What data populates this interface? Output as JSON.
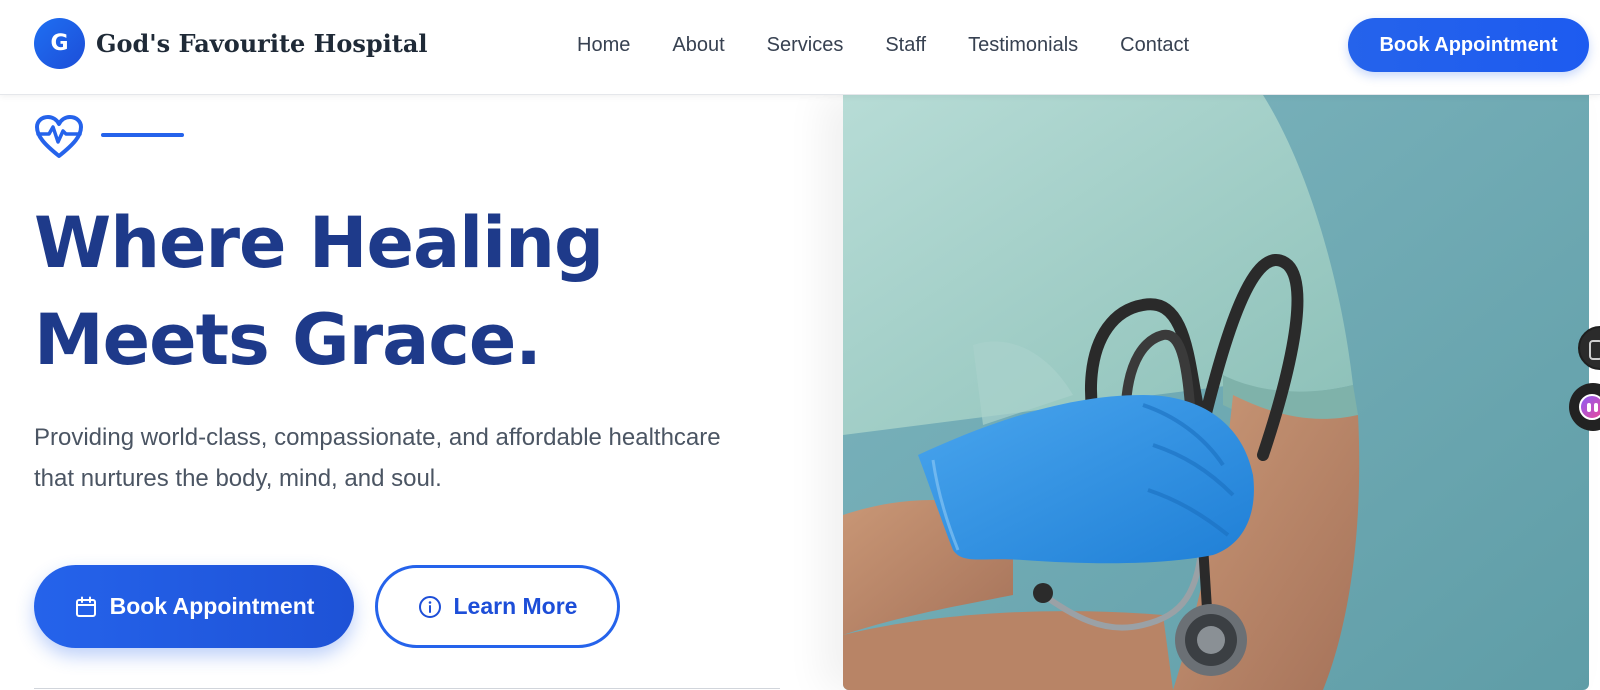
{
  "header": {
    "logo_letter": "G",
    "logo_text": "God's Favourite Hospital",
    "nav": [
      {
        "label": "Home"
      },
      {
        "label": "About"
      },
      {
        "label": "Services"
      },
      {
        "label": "Staff"
      },
      {
        "label": "Testimonials"
      },
      {
        "label": "Contact"
      }
    ],
    "cta_label": "Book Appointment"
  },
  "hero": {
    "title_line1": "Where Healing",
    "title_line2": "Meets Grace.",
    "subtitle_line1": "Providing world-class, compassionate, and affordable healthcare",
    "subtitle_line2": "that nurtures the body, mind, and soul.",
    "primary_button": "Book Appointment",
    "secondary_button": "Learn More",
    "accent_icon": "heart-pulse-icon",
    "primary_icon": "calendar-icon",
    "secondary_icon": "info-icon"
  },
  "colors": {
    "accent": "#2563eb",
    "heading": "#1e3a8a",
    "text_muted": "#4b5563",
    "image_background": "#6eaab3",
    "glove": "#2f8fe0",
    "scrubs": "#9cc9c2"
  }
}
